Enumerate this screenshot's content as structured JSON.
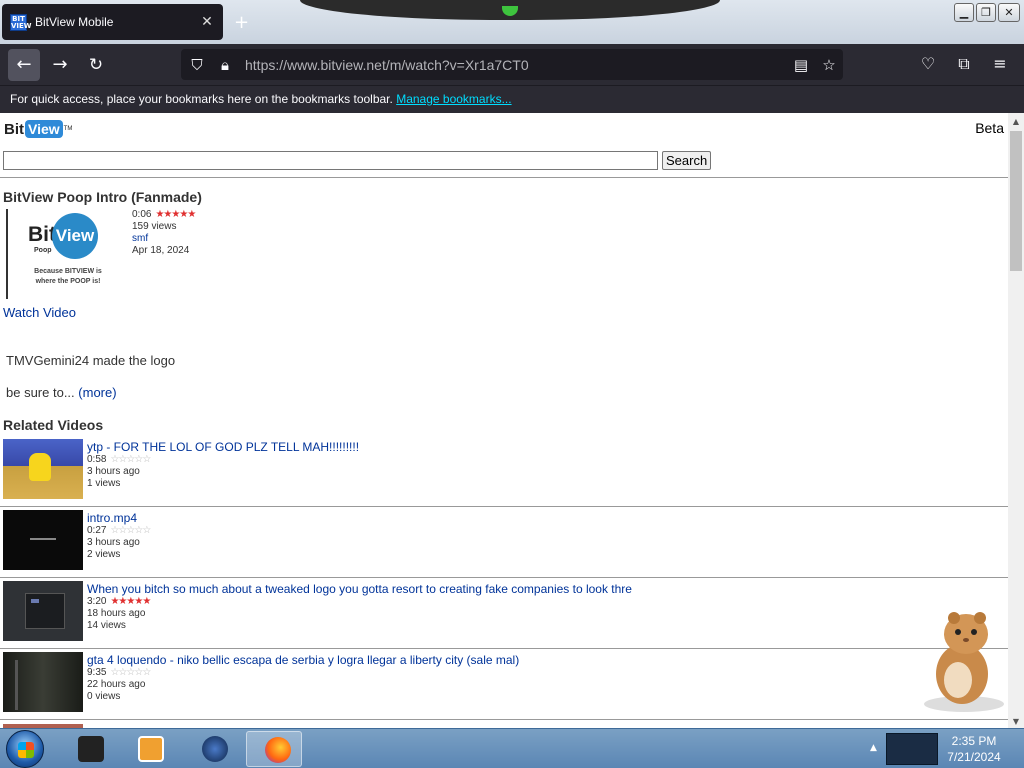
{
  "browser": {
    "tab_title": "BitView Mobile",
    "tab_favicon_label": "BIT VIEW",
    "close_tab_glyph": "✕",
    "new_tab_glyph": "+",
    "url": "https://www.bitview.net/m/watch?v=Xr1a7CT0",
    "icons": [
      "back-arrow-icon",
      "forward-arrow-icon",
      "reload-icon",
      "shield-icon",
      "lock-icon",
      "reader-view-icon",
      "bookmark-star-icon",
      "pocket-icon",
      "extensions-icon",
      "menu-icon"
    ],
    "bookmarks_message": "For quick access, place your bookmarks here on the bookmarks toolbar.",
    "manage_bookmarks": "Manage bookmarks..."
  },
  "site": {
    "logo_bit": "Bit",
    "logo_view": "View",
    "logo_tm": "TM",
    "beta": "Beta",
    "search_button": "Search",
    "search_value": ""
  },
  "video": {
    "title": "BitView Poop Intro (Fanmade)",
    "thumbnail_bit": "Bit",
    "thumbnail_view": "View",
    "thumbnail_poop": "Poop",
    "thumbnail_tagline": "Because BITVIEW is where the POOP is!",
    "duration": "0:06",
    "stars": "★★★★★",
    "rating": 5,
    "views": "159 views",
    "author": "smf",
    "date": "Apr 18, 2024",
    "watch_label": "Watch Video",
    "desc_line1": "TMVGemini24 made the logo",
    "desc_line2": "be sure to...",
    "more_label": "(more)"
  },
  "related": {
    "heading": "Related Videos",
    "items": [
      {
        "title": "ytp - FOR THE LOL OF GOD PLZ TELL MAH!!!!!!!!!",
        "duration": "0:58",
        "stars": "☆☆☆☆☆",
        "rating": 0,
        "ago": "3 hours ago",
        "views": "1 views",
        "thumb_color": "#3a4fb0"
      },
      {
        "title": "intro.mp4",
        "duration": "0:27",
        "stars": "☆☆☆☆☆",
        "rating": 0,
        "ago": "3 hours ago",
        "views": "2 views",
        "thumb_color": "#0a0a0a"
      },
      {
        "title": "When you bitch so much about a tweaked logo you gotta resort to creating fake companies to look thre",
        "duration": "3:20",
        "stars": "★★★★★",
        "rating": 5,
        "ago": "18 hours ago",
        "views": "14 views",
        "thumb_color": "#2f3236"
      },
      {
        "title": "gta 4 loquendo - niko bellic escapa de serbia y logra llegar a liberty city (sale mal)",
        "duration": "9:35",
        "stars": "☆☆☆☆☆",
        "rating": 0,
        "ago": "22 hours ago",
        "views": "0 views",
        "thumb_color": "#23251f"
      }
    ]
  },
  "taskbar": {
    "time": "2:35 PM",
    "date": "7/21/2024"
  }
}
